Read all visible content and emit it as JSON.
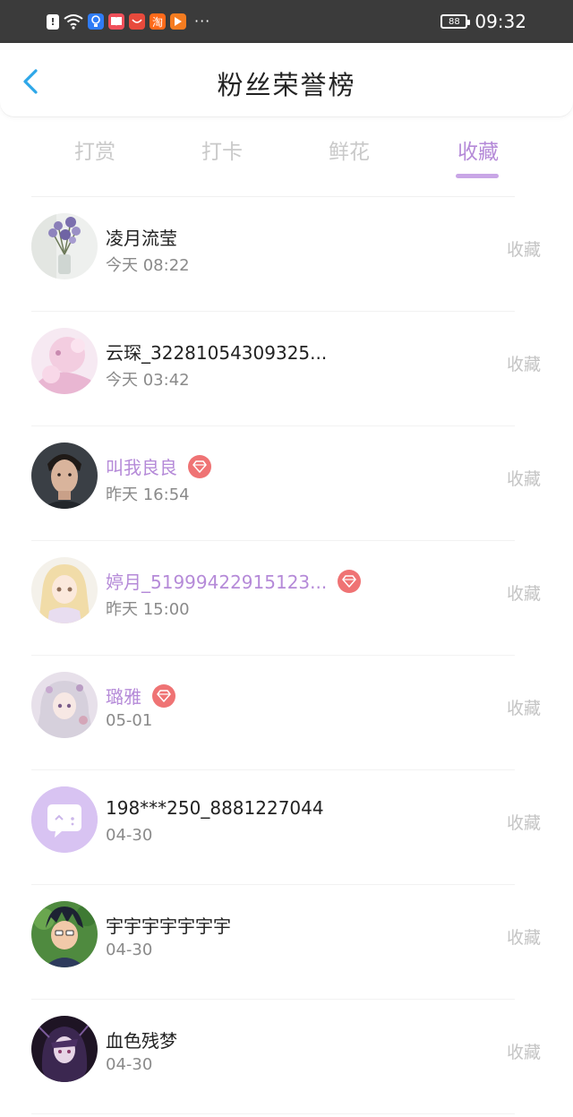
{
  "status_bar": {
    "time": "09:32",
    "battery": "88",
    "more": "···",
    "app_icons": [
      {
        "icon": "alert-icon",
        "glyph": "!",
        "color": "#ffffff",
        "fg": "#3b3b3b"
      },
      {
        "icon": "wifi-icon",
        "glyph": "",
        "color": "transparent",
        "fg": "#ffffff"
      },
      {
        "icon": "bulb-app-icon",
        "glyph": "",
        "color": "#2f7cf6",
        "fg": "#ffffff"
      },
      {
        "icon": "book-app-icon",
        "glyph": "",
        "color": "#f0505a",
        "fg": "#ffffff"
      },
      {
        "icon": "shop-app-icon",
        "glyph": "",
        "color": "#e84a3c",
        "fg": "#ffffff"
      },
      {
        "icon": "taobao-app-icon",
        "glyph": "淘",
        "color": "#ff6a1a",
        "fg": "#ffffff"
      },
      {
        "icon": "video-app-icon",
        "glyph": "▶",
        "color": "#f57c20",
        "fg": "#ffffff"
      }
    ]
  },
  "header": {
    "title": "粉丝荣誉榜"
  },
  "tabs": [
    {
      "label": "打赏",
      "active": false
    },
    {
      "label": "打卡",
      "active": false
    },
    {
      "label": "鲜花",
      "active": false
    },
    {
      "label": "收藏",
      "active": true
    }
  ],
  "accent": "#b58ad8",
  "fans": [
    {
      "name": "凌月流莹",
      "time": "今天 08:22",
      "action": "收藏",
      "vip": false,
      "avatar": "flower-avatar"
    },
    {
      "name": "云琛_32281054309325...",
      "time": "今天 03:42",
      "action": "收藏",
      "vip": false,
      "avatar": "pink-anime-avatar"
    },
    {
      "name": "叫我良良",
      "time": "昨天 16:54",
      "action": "收藏",
      "vip": true,
      "avatar": "man-portrait-avatar"
    },
    {
      "name": "婷月_51999422915123...",
      "time": "昨天 15:00",
      "action": "收藏",
      "vip": true,
      "avatar": "blonde-anime-avatar"
    },
    {
      "name": "璐雅",
      "time": "05-01",
      "action": "收藏",
      "vip": true,
      "avatar": "silver-anime-avatar"
    },
    {
      "name": "198***250_8881227044",
      "time": "04-30",
      "action": "收藏",
      "vip": false,
      "avatar": "default-chat-avatar"
    },
    {
      "name": "宇宇宇宇宇宇宇",
      "time": "04-30",
      "action": "收藏",
      "vip": false,
      "avatar": "boy-anime-avatar"
    },
    {
      "name": "血色残梦",
      "time": "04-30",
      "action": "收藏",
      "vip": false,
      "avatar": "dark-anime-avatar"
    }
  ]
}
